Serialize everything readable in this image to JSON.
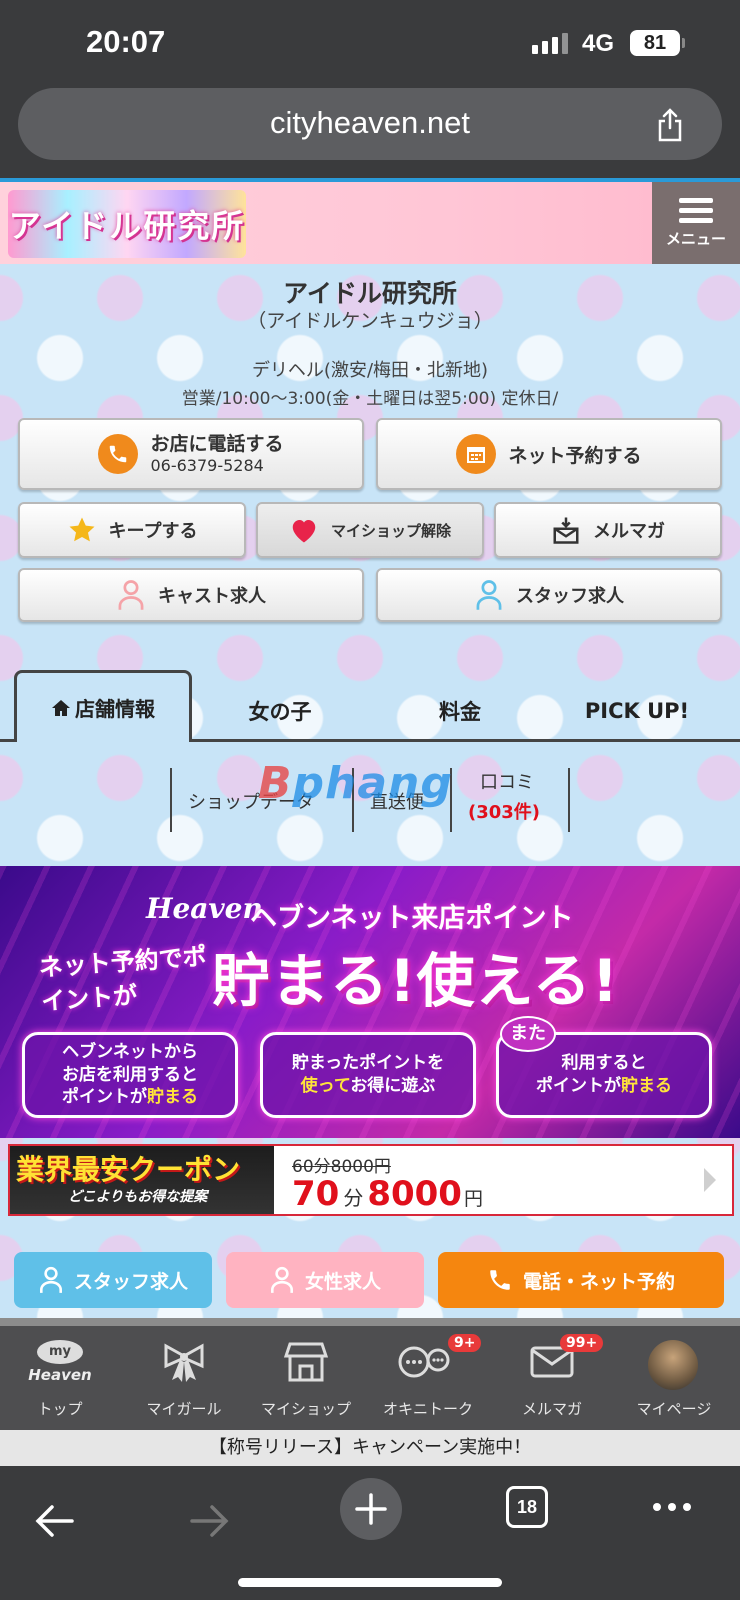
{
  "status_bar": {
    "time": "20:07",
    "network": "4G",
    "battery": "81"
  },
  "browser": {
    "url": "cityheaven.net",
    "tab_count": "18"
  },
  "header": {
    "logo_text": "アイドル研究所",
    "menu_label": "メニュー"
  },
  "shop": {
    "name": "アイドル研究所",
    "kana": "（アイドルケンキュウジョ）",
    "genre": "デリヘル(激安/梅田・北新地)",
    "hours": "営業/10:00〜3:00(金・土曜日は翌5:00) 定休日/"
  },
  "buttons": {
    "call_label": "お店に電話する",
    "call_number": "06-6379-5284",
    "reserve": "ネット予約する",
    "keep": "キープする",
    "myshop_remove": "マイショップ解除",
    "mailmag": "メルマガ",
    "cast_recruit": "キャスト求人",
    "staff_recruit": "スタッフ求人"
  },
  "tabs": [
    "店舗情報",
    "女の子",
    "料金",
    "PICK UP!"
  ],
  "subnav": {
    "shop_data": "ショップデータ",
    "direct_mail": "直送便",
    "reviews": "口コミ",
    "reviews_count": "(303件)"
  },
  "watermark": {
    "part1": "B",
    "part2": "phang"
  },
  "banner": {
    "logo": "Heaven",
    "title": "ヘブンネット来店ポイント",
    "left_text": "ネット予約でポイントが",
    "main": "貯まる!使える!",
    "box1_line1": "ヘブンネットから",
    "box1_line2": "お店を利用すると",
    "box1_line3a": "ポイントが",
    "box1_line3b": "貯まる",
    "box2_line1": "貯まったポイントを",
    "box2_line2a": "使って",
    "box2_line2b": "お得に遊ぶ",
    "mata": "また",
    "box3_line1": "利用すると",
    "box3_line2a": "ポイントが",
    "box3_line2b": "貯まる"
  },
  "coupon": {
    "label": "業界最安クーポン",
    "sublabel": "どこよりもお得な提案",
    "old_price": "60分8000円",
    "new_minutes": "70",
    "minute_unit": "分",
    "new_price": "8000",
    "yen": "円"
  },
  "actions": {
    "staff": "スタッフ求人",
    "female": "女性求人",
    "call": "電話・ネット予約"
  },
  "tabbar": {
    "items": [
      "トップ",
      "マイガール",
      "マイショップ",
      "オキニトーク",
      "メルマガ",
      "マイページ"
    ],
    "top_icon_line1": "my",
    "top_icon_line2": "Heaven",
    "badge_talk": "9+",
    "badge_mail": "99+"
  },
  "promo": "【称号リリース】キャンペーン実施中！",
  "colors": {
    "orange": "#f08a1c",
    "light_blue": "#5fc0e8",
    "pink": "#ffb3c1",
    "red": "#e0101c"
  }
}
